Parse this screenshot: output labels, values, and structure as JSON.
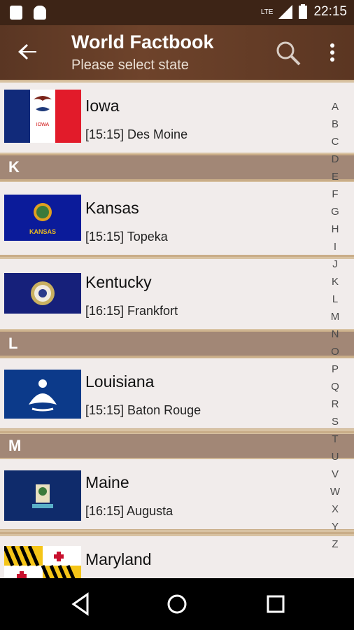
{
  "status_bar": {
    "network": "LTE",
    "time": "22:15"
  },
  "app_bar": {
    "title": "World Factbook",
    "subtitle": "Please select state"
  },
  "rows": [
    {
      "name": "Iowa",
      "detail": "[15:15] Des Moine"
    },
    {
      "name": "Kansas",
      "detail": "[15:15] Topeka"
    },
    {
      "name": "Kentucky",
      "detail": "[16:15] Frankfort"
    },
    {
      "name": "Louisiana",
      "detail": "[15:15] Baton Rouge"
    },
    {
      "name": "Maine",
      "detail": "[16:15] Augusta"
    },
    {
      "name": "Maryland",
      "detail": ""
    }
  ],
  "flag_text": {
    "iowa": "IOWA",
    "kansas": "KANSAS"
  },
  "section_headers": [
    "K",
    "L",
    "M"
  ],
  "alphabet": [
    "A",
    "B",
    "C",
    "D",
    "E",
    "F",
    "G",
    "H",
    "I",
    "J",
    "K",
    "L",
    "M",
    "N",
    "O",
    "P",
    "Q",
    "R",
    "S",
    "T",
    "U",
    "V",
    "W",
    "X",
    "Y",
    "Z"
  ],
  "colors": {
    "app_bar": "#5a3623",
    "status_bar": "#3d2416",
    "section_header": "#a28776",
    "row": "#f1eceb"
  }
}
